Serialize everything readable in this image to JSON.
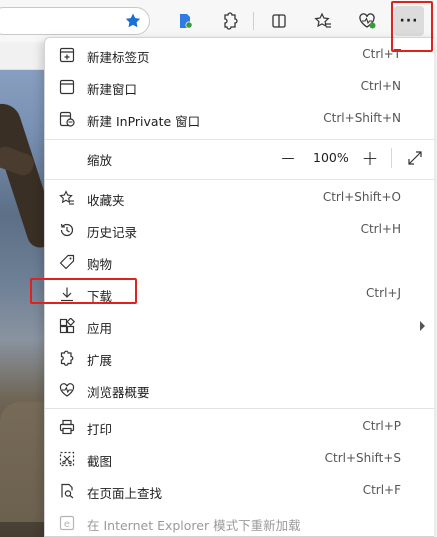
{
  "colors": {
    "highlight": "#e0221f",
    "menu_bg": "#ffffff",
    "star_blue": "#1a6fd6"
  },
  "toolbar": {
    "icons": [
      "star-filled-icon",
      "feed-icon",
      "extensions-icon",
      "split-screen-icon",
      "favorites-icon",
      "browser-essentials-icon",
      "more-icon"
    ],
    "more_label": "···"
  },
  "menu": {
    "new_tab": {
      "label": "新建标签页",
      "shortcut": "Ctrl+T"
    },
    "new_window": {
      "label": "新建窗口",
      "shortcut": "Ctrl+N"
    },
    "new_inprivate": {
      "label": "新建 InPrivate 窗口",
      "shortcut": "Ctrl+Shift+N"
    },
    "zoom": {
      "label": "缩放",
      "minus": "—",
      "value": "100%",
      "plus": "+"
    },
    "favorites": {
      "label": "收藏夹",
      "shortcut": "Ctrl+Shift+O"
    },
    "history": {
      "label": "历史记录",
      "shortcut": "Ctrl+H"
    },
    "shopping": {
      "label": "购物"
    },
    "downloads": {
      "label": "下载",
      "shortcut": "Ctrl+J"
    },
    "apps": {
      "label": "应用"
    },
    "extensions": {
      "label": "扩展"
    },
    "browser_essentials": {
      "label": "浏览器概要"
    },
    "print": {
      "label": "打印",
      "shortcut": "Ctrl+P"
    },
    "screenshot": {
      "label": "截图",
      "shortcut": "Ctrl+Shift+S"
    },
    "find": {
      "label": "在页面上查找",
      "shortcut": "Ctrl+F"
    },
    "ie_mode": {
      "label": "在 Internet Explorer 模式下重新加载"
    }
  }
}
